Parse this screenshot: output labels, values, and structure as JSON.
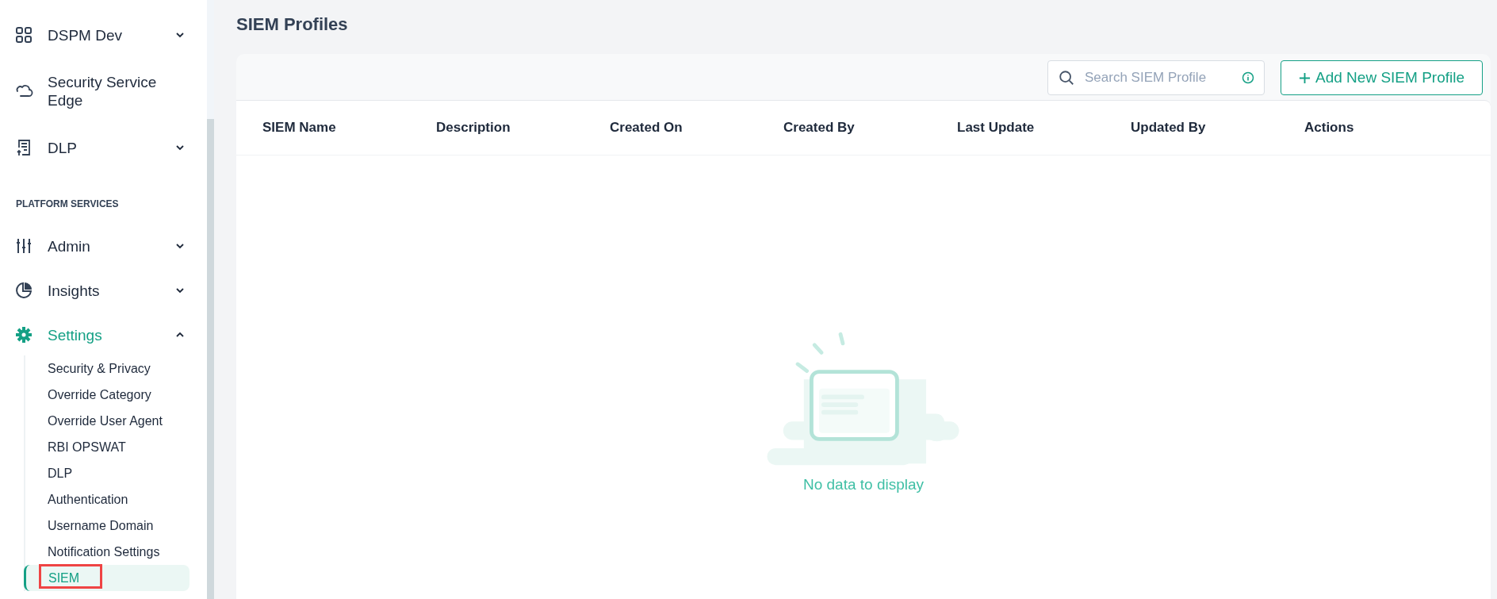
{
  "sidebar": {
    "sections": [
      {
        "items": [
          {
            "label": "DSPM Dev",
            "expanded": false,
            "selected": false
          },
          {
            "label": "Security Service Edge",
            "selected": false
          },
          {
            "label": "DLP",
            "expanded": false,
            "selected": false
          }
        ]
      },
      {
        "heading": "PLATFORM SERVICES",
        "items": [
          {
            "label": "Admin",
            "expanded": false,
            "selected": false
          },
          {
            "label": "Insights",
            "expanded": false,
            "selected": false
          },
          {
            "label": "Settings",
            "expanded": true,
            "selected": true,
            "children": [
              {
                "label": "Security & Privacy",
                "selected": false
              },
              {
                "label": "Override Category",
                "selected": false
              },
              {
                "label": "Override User Agent",
                "selected": false
              },
              {
                "label": "RBI OPSWAT",
                "selected": false
              },
              {
                "label": "DLP",
                "selected": false
              },
              {
                "label": "Authentication",
                "selected": false
              },
              {
                "label": "Username Domain",
                "selected": false
              },
              {
                "label": "Notification Settings",
                "selected": false
              },
              {
                "label": "SIEM",
                "selected": true,
                "annotated": true
              }
            ]
          }
        ]
      }
    ]
  },
  "page": {
    "title": "SIEM Profiles"
  },
  "search": {
    "placeholder": "Search SIEM Profile"
  },
  "add_button": {
    "label": "Add New SIEM Profile"
  },
  "table": {
    "columns": [
      "SIEM Name",
      "Description",
      "Created On",
      "Created By",
      "Last Update",
      "Updated By",
      "Actions"
    ],
    "empty_message": "No data to display"
  }
}
